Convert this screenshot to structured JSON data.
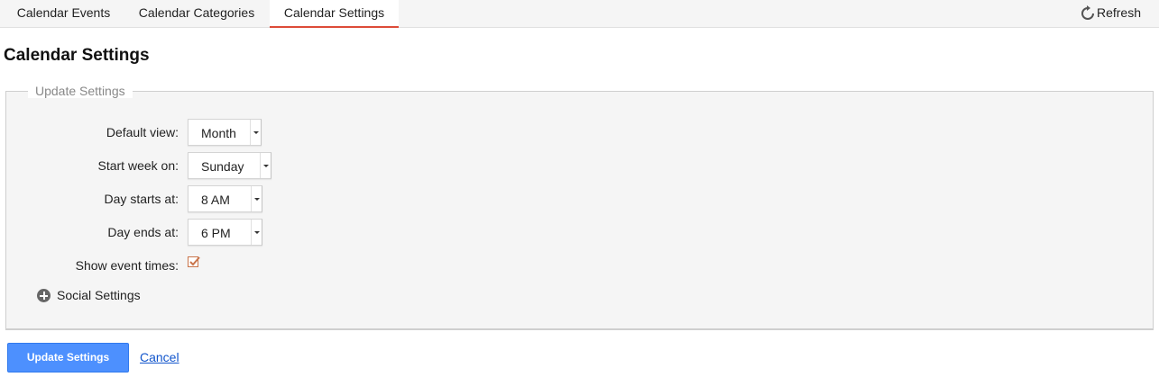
{
  "tabs": [
    {
      "label": "Calendar Events"
    },
    {
      "label": "Calendar Categories"
    },
    {
      "label": "Calendar Settings",
      "active": true
    }
  ],
  "toolbar": {
    "refresh_label": "Refresh",
    "refresh_icon": "refresh-icon"
  },
  "page_title": "Calendar Settings",
  "form": {
    "legend": "Update Settings",
    "fields": {
      "default_view": {
        "label": "Default view:",
        "value": "Month"
      },
      "start_week": {
        "label": "Start week on:",
        "value": "Sunday"
      },
      "day_starts": {
        "label": "Day starts at:",
        "value": "8 AM"
      },
      "day_ends": {
        "label": "Day ends at:",
        "value": "6 PM"
      },
      "show_times": {
        "label": "Show event times:",
        "checked": true
      }
    },
    "social_label": "Social Settings",
    "social_icon": "plus-circle-icon"
  },
  "actions": {
    "update_label": "Update Settings",
    "cancel_label": "Cancel"
  },
  "colors": {
    "accent": "#dd4b39",
    "primary_button": "#4d90fe",
    "link": "#1155cc",
    "checkbox": "#c9744a"
  }
}
